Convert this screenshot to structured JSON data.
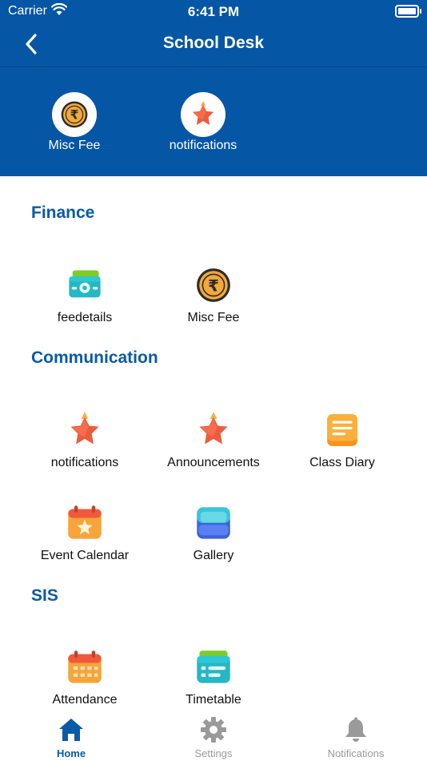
{
  "status_bar": {
    "carrier": "Carrier",
    "time": "6:41 PM"
  },
  "navbar": {
    "title": "School Desk"
  },
  "quick_actions": [
    {
      "label": "Misc Fee",
      "icon": "rupee-coin-icon"
    },
    {
      "label": "notifications",
      "icon": "star-icon"
    }
  ],
  "sections": [
    {
      "title": "Finance",
      "items": [
        {
          "label": "feedetails",
          "icon": "cash-icon"
        },
        {
          "label": "Misc Fee",
          "icon": "rupee-coin-icon"
        }
      ]
    },
    {
      "title": "Communication",
      "items": [
        {
          "label": "notifications",
          "icon": "star-icon"
        },
        {
          "label": "Announcements",
          "icon": "star-icon"
        },
        {
          "label": "Class Diary",
          "icon": "notes-icon"
        },
        {
          "label": "Event Calendar",
          "icon": "calendar-star-icon"
        },
        {
          "label": "Gallery",
          "icon": "gallery-icon"
        }
      ]
    },
    {
      "title": "SIS",
      "items": [
        {
          "label": "Attendance",
          "icon": "calendar-icon"
        },
        {
          "label": "Timetable",
          "icon": "timetable-icon"
        }
      ]
    }
  ],
  "tabbar": [
    {
      "label": "Home",
      "icon": "home-icon",
      "active": true
    },
    {
      "label": "Settings",
      "icon": "gear-icon",
      "active": false
    },
    {
      "label": "Notifications",
      "icon": "bell-icon",
      "active": false
    }
  ],
  "colors": {
    "header": "#0656a6",
    "section_title": "#0a5aa8",
    "tab_active": "#0a5aa8",
    "tab_inactive": "#9a9a9a"
  }
}
